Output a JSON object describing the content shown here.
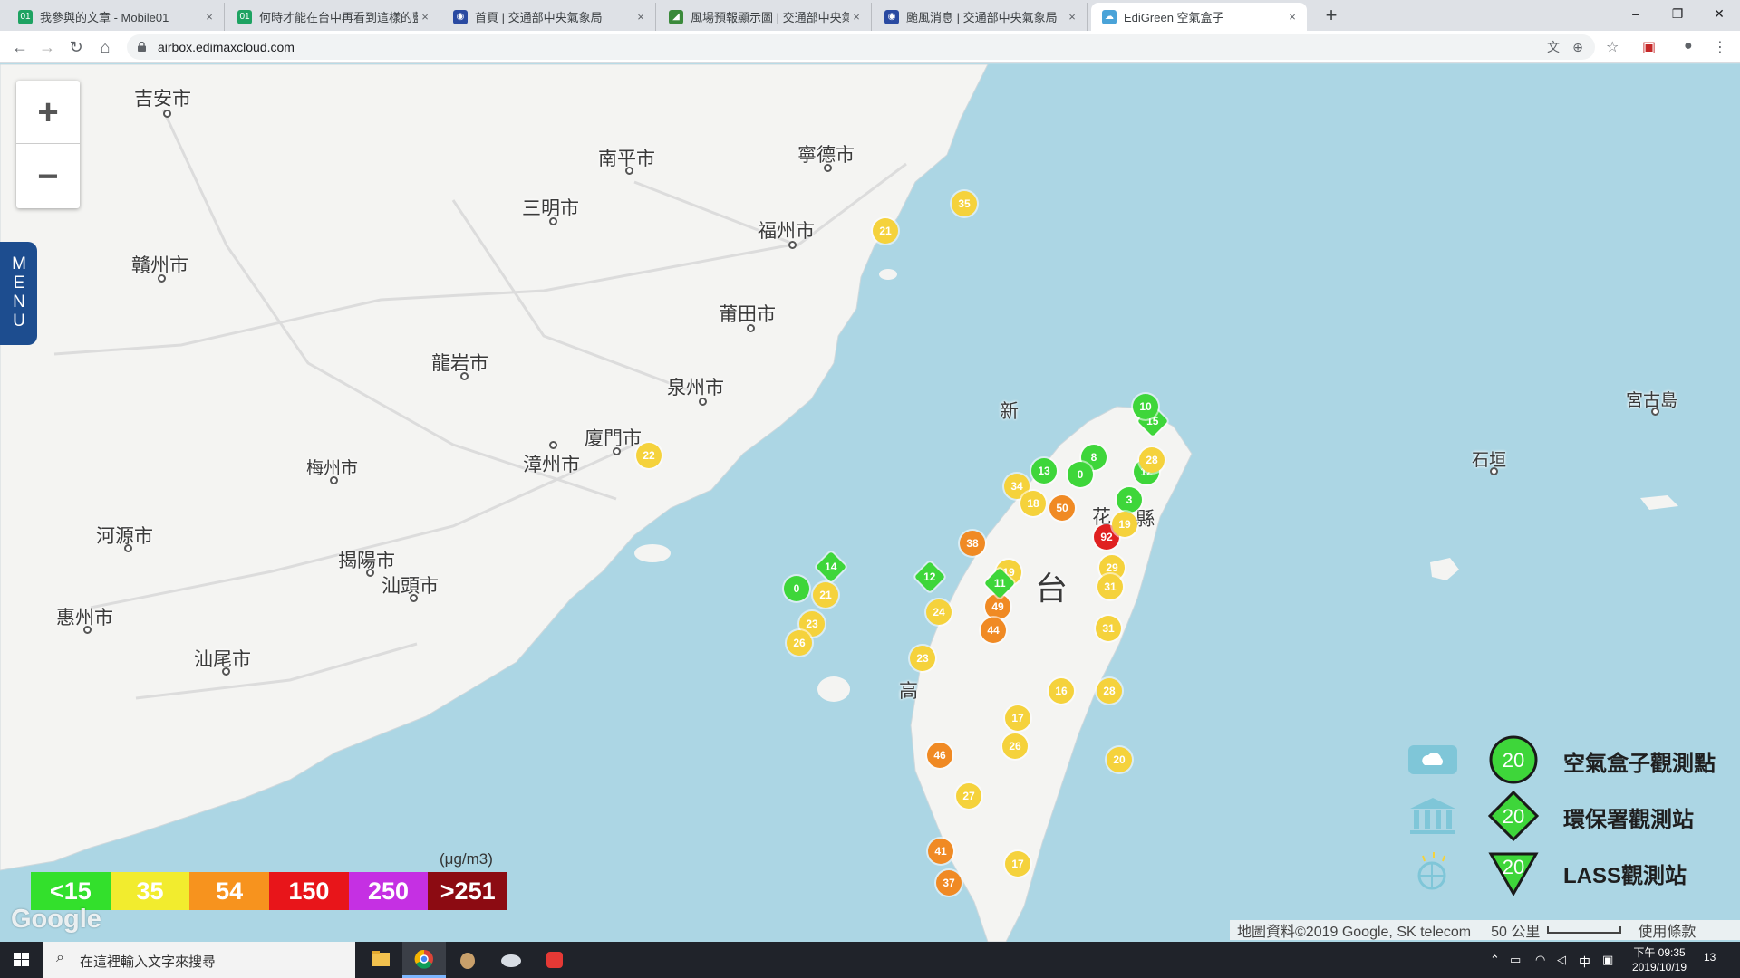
{
  "browser": {
    "tabs": [
      {
        "title": "我參與的文章 - Mobile01",
        "favicon_color": "#1ea362"
      },
      {
        "title": "何時才能在台中再看到這樣的藍天",
        "favicon_color": "#1ea362"
      },
      {
        "title": "首頁 | 交通部中央氣象局",
        "favicon_color": "#2a4aa1"
      },
      {
        "title": "風場預報顯示圖 | 交通部中央氣象局",
        "favicon_color": "#3b8a3b"
      },
      {
        "title": "颱風消息 | 交通部中央氣象局",
        "favicon_color": "#2a4aa1"
      },
      {
        "title": "EdiGreen 空氣盒子",
        "favicon_color": "#4aa3d8"
      }
    ],
    "close_glyph": "×",
    "new_tab_glyph": "+",
    "url": "airbox.edimaxcloud.com",
    "window_controls": {
      "minimize": "–",
      "maximize": "❐",
      "close": "✕"
    }
  },
  "map": {
    "zoom_in_label": "+",
    "zoom_out_label": "−",
    "menu_label": "MENU",
    "cities": [
      {
        "name": "吉安市"
      },
      {
        "name": "南平市"
      },
      {
        "name": "寧德市"
      },
      {
        "name": "三明市"
      },
      {
        "name": "福州市"
      },
      {
        "name": "贛州市"
      },
      {
        "name": "莆田市"
      },
      {
        "name": "龍岩市"
      },
      {
        "name": "泉州市"
      },
      {
        "name": "廈門市"
      },
      {
        "name": "漳州市"
      },
      {
        "name": "梅州市"
      },
      {
        "name": "河源市"
      },
      {
        "name": "揭陽市"
      },
      {
        "name": "汕頭市"
      },
      {
        "name": "惠州市"
      },
      {
        "name": "汕尾市"
      },
      {
        "name": "宮古島"
      },
      {
        "name": "石垣"
      },
      {
        "name": "台"
      },
      {
        "name": "花"
      },
      {
        "name": "縣"
      },
      {
        "name": "新"
      },
      {
        "name": "高"
      }
    ],
    "markers": [
      {
        "value": "35",
        "level": "moderate"
      },
      {
        "value": "21",
        "level": "moderate"
      },
      {
        "value": "22",
        "level": "moderate"
      },
      {
        "value": "14",
        "level": "good",
        "shape": "diamond"
      },
      {
        "value": "0",
        "level": "good"
      },
      {
        "value": "21",
        "level": "moderate"
      },
      {
        "value": "23",
        "level": "moderate"
      },
      {
        "value": "26",
        "level": "moderate"
      },
      {
        "value": "50",
        "level": "unhealthy-sensitive"
      },
      {
        "value": "92",
        "level": "unhealthy"
      },
      {
        "value": "49",
        "level": "unhealthy-sensitive"
      },
      {
        "value": "44",
        "level": "unhealthy-sensitive"
      },
      {
        "value": "8",
        "level": "good"
      },
      {
        "value": "0",
        "level": "good"
      },
      {
        "value": "12",
        "level": "good"
      },
      {
        "value": "3",
        "level": "good"
      },
      {
        "value": "19",
        "level": "moderate"
      },
      {
        "value": "28",
        "level": "moderate"
      },
      {
        "value": "15",
        "level": "good",
        "shape": "diamond"
      },
      {
        "value": "10",
        "level": "good"
      },
      {
        "value": "31",
        "level": "moderate"
      },
      {
        "value": "29",
        "level": "moderate"
      },
      {
        "value": "31",
        "level": "moderate"
      },
      {
        "value": "28",
        "level": "moderate"
      },
      {
        "value": "16",
        "level": "moderate"
      },
      {
        "value": "17",
        "level": "moderate"
      },
      {
        "value": "26",
        "level": "moderate"
      },
      {
        "value": "20",
        "level": "moderate"
      },
      {
        "value": "34",
        "level": "moderate"
      },
      {
        "value": "18",
        "level": "moderate"
      },
      {
        "value": "19",
        "level": "moderate"
      },
      {
        "value": "12",
        "level": "good",
        "shape": "diamond"
      },
      {
        "value": "38",
        "level": "unhealthy-sensitive"
      },
      {
        "value": "24",
        "level": "moderate"
      },
      {
        "value": "37",
        "level": "unhealthy-sensitive"
      },
      {
        "value": "41",
        "level": "unhealthy-sensitive"
      },
      {
        "value": "13",
        "level": "good"
      },
      {
        "value": "11",
        "level": "good",
        "shape": "diamond"
      },
      {
        "value": "23",
        "level": "moderate"
      },
      {
        "value": "27",
        "level": "moderate"
      },
      {
        "value": "46",
        "level": "unhealthy-sensitive"
      },
      {
        "value": "17",
        "level": "moderate"
      }
    ],
    "aqi_scale": {
      "unit": "(μg/m3)",
      "levels": [
        {
          "label": "<15",
          "color": "#33e02c"
        },
        {
          "label": "35",
          "color": "#f2ec2e"
        },
        {
          "label": "54",
          "color": "#f7931e"
        },
        {
          "label": "150",
          "color": "#e8151a"
        },
        {
          "label": "250",
          "color": "#c530e3"
        },
        {
          "label": ">251",
          "color": "#8c0b12"
        }
      ]
    },
    "type_legend": [
      {
        "label": "空氣盒子觀測點",
        "value": "20",
        "icon": "airbox-icon"
      },
      {
        "label": "環保署觀測站",
        "value": "20",
        "icon": "epa-building-icon"
      },
      {
        "label": "LASS觀測站",
        "value": "20",
        "icon": "lass-sensor-icon"
      }
    ],
    "google_logo": "Google",
    "attribution": "地圖資料©2019 Google, SK telecom",
    "scale_label": "50 公里",
    "terms_label": "使用條款",
    "colors": {
      "good": "#3ed63a",
      "moderate": "#f5d23c",
      "unhealthy-sensitive": "#f08a24",
      "unhealthy": "#e02020",
      "sea": "#acd6e4",
      "land": "#f4f4f2"
    }
  },
  "taskbar": {
    "search_placeholder": "在這裡輸入文字來搜尋",
    "tray_ime": "中",
    "time": "下午 09:35",
    "date": "2019/10/19",
    "notification_count": "13"
  }
}
